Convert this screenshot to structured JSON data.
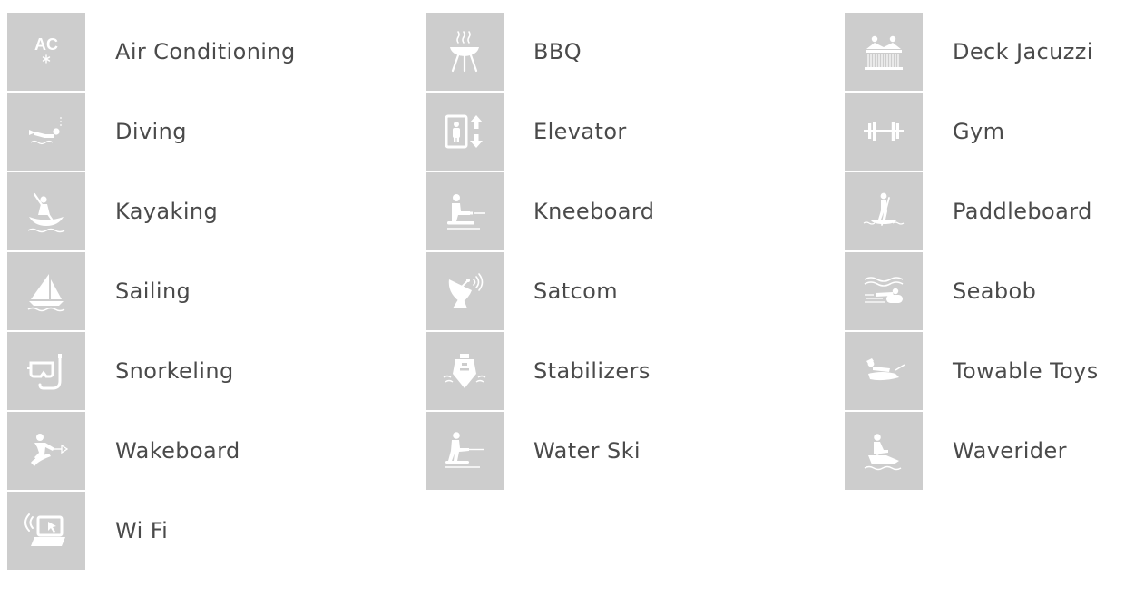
{
  "colors": {
    "tile_background": "#cdcdcd",
    "icon": "#ffffff",
    "label_text": "#4a4a4a",
    "page_background": "#ffffff"
  },
  "amenities": {
    "air_conditioning": {
      "label": "Air Conditioning",
      "icon": "air-conditioning-icon",
      "icon_text": "AC"
    },
    "bbq": {
      "label": "BBQ",
      "icon": "bbq-grill-icon"
    },
    "deck_jacuzzi": {
      "label": "Deck Jacuzzi",
      "icon": "deck-jacuzzi-icon"
    },
    "diving": {
      "label": "Diving",
      "icon": "diving-icon"
    },
    "elevator": {
      "label": "Elevator",
      "icon": "elevator-icon"
    },
    "gym": {
      "label": "Gym",
      "icon": "dumbbell-icon"
    },
    "kayaking": {
      "label": "Kayaking",
      "icon": "kayak-icon"
    },
    "kneeboard": {
      "label": "Kneeboard",
      "icon": "kneeboard-icon"
    },
    "paddleboard": {
      "label": "Paddleboard",
      "icon": "paddleboard-icon"
    },
    "sailing": {
      "label": "Sailing",
      "icon": "sailboat-icon"
    },
    "satcom": {
      "label": "Satcom",
      "icon": "satellite-dish-icon"
    },
    "seabob": {
      "label": "Seabob",
      "icon": "seabob-icon"
    },
    "snorkeling": {
      "label": "Snorkeling",
      "icon": "snorkel-mask-icon"
    },
    "stabilizers": {
      "label": "Stabilizers",
      "icon": "boat-stabilizer-icon"
    },
    "towable_toys": {
      "label": "Towable Toys",
      "icon": "towable-toy-icon"
    },
    "wakeboard": {
      "label": "Wakeboard",
      "icon": "wakeboard-icon"
    },
    "water_ski": {
      "label": "Water Ski",
      "icon": "water-ski-icon"
    },
    "waverider": {
      "label": "Waverider",
      "icon": "jet-ski-icon"
    },
    "wifi": {
      "label": "Wi Fi",
      "icon": "wifi-laptop-icon"
    }
  }
}
